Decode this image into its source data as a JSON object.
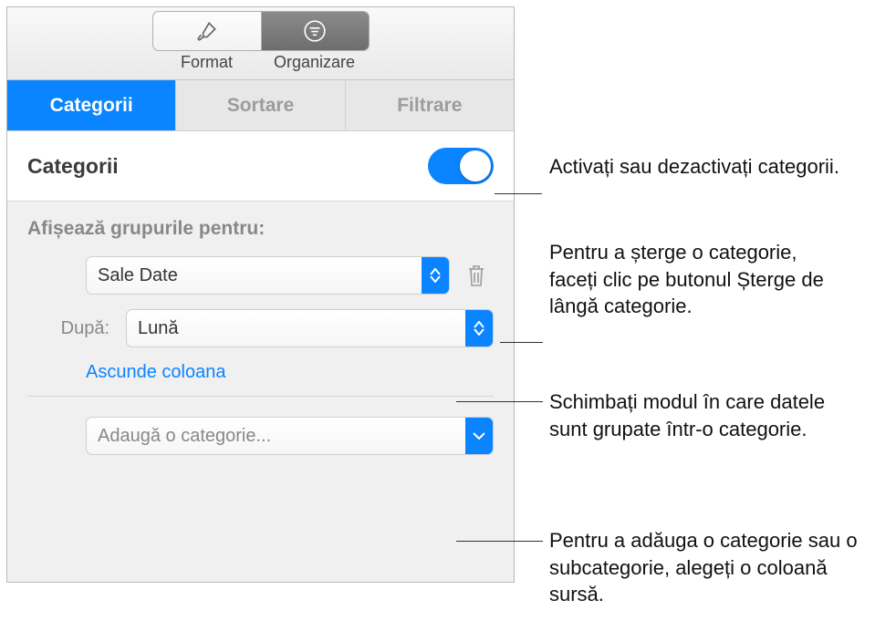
{
  "toolbar": {
    "format": {
      "label": "Format"
    },
    "organize": {
      "label": "Organizare"
    }
  },
  "tabs": {
    "categories": "Categorii",
    "sort": "Sortare",
    "filter": "Filtrare"
  },
  "section": {
    "title": "Categorii"
  },
  "group": {
    "label": "Afișează grupurile pentru:",
    "field_value": "Sale Date",
    "by_label": "După:",
    "by_value": "Lună",
    "hide_column": "Ascunde coloana",
    "add_category": "Adaugă o categorie..."
  },
  "callouts": {
    "toggle": "Activați sau dezactivați categorii.",
    "delete": "Pentru a șterge o categorie, faceți clic pe butonul Șterge de lângă categorie.",
    "change": "Schimbați modul în care datele sunt grupate într-o categorie.",
    "add": "Pentru a adăuga o categorie sau o subcategorie, alegeți o coloană sursă."
  }
}
